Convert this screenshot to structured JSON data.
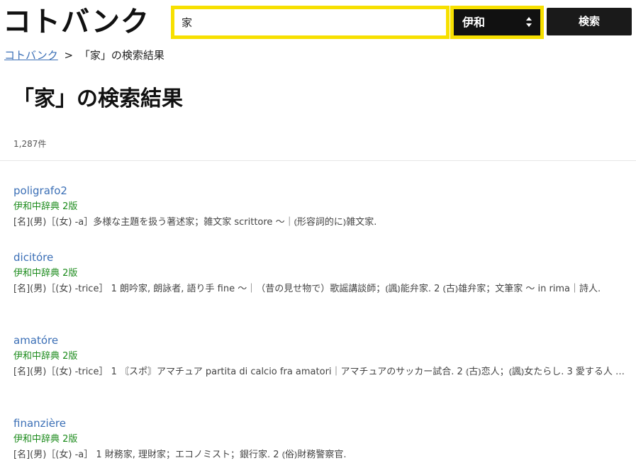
{
  "header": {
    "logo": "コトバンク",
    "search_value": "家",
    "dictionary_selected": "伊和",
    "search_button": "検索"
  },
  "breadcrumb": {
    "home": "コトバンク",
    "separator": ">",
    "current": "「家」の検索結果"
  },
  "page_title": "「家」の検索結果",
  "result_count": "1,287件",
  "results": [
    {
      "title": "poligrafo2",
      "source": "伊和中辞典 2版",
      "snippet": "[名](男)［(女) -a］多様な主題を扱う著述家；雑文家 scrittore 〜｜⦅形容詞的に⦆雑文家."
    },
    {
      "title": "dicitóre",
      "source": "伊和中辞典 2版",
      "snippet": "[名](男)［(女) -trice］ 1 朗吟家, 朗詠者, 語り手 fine 〜｜（昔の見せ物で）歌謡講談師；⦅諷⦆能弁家. 2 ⦅古⦆雄弁家；文筆家 〜 in rima｜詩人."
    },
    {
      "title": "amatóre",
      "source": "伊和中辞典 2版",
      "snippet": "[名](男)［(女) -trice］ 1 〘スポ〙アマチュア partita di calcio fra amatori｜アマチュアのサッカー試合. 2 ⦅古⦆恋人；⦅諷⦆女たらし. 3 愛する人 …"
    },
    {
      "title": "finanzière",
      "source": "伊和中辞典 2版",
      "snippet": "[名](男)［(女) -a］ 1 財務家, 理財家；エコノミスト；銀行家. 2 ⦅俗⦆財務警察官."
    }
  ]
}
